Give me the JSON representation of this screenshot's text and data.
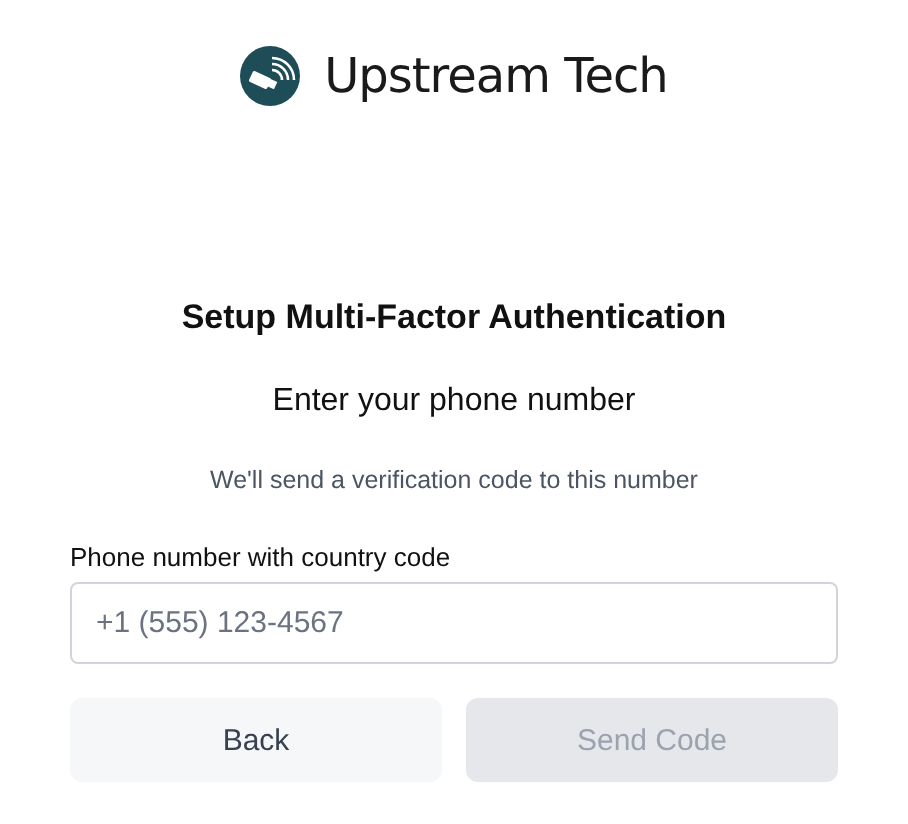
{
  "logo": {
    "name": "Upstream Tech"
  },
  "title": "Setup Multi-Factor Authentication",
  "subtitle": "Enter your phone number",
  "description": "We'll send a verification code to this number",
  "phone_field": {
    "label": "Phone number with country code",
    "placeholder": "+1 (555) 123-4567"
  },
  "buttons": [
    {
      "label": "Back",
      "disabled": false
    },
    {
      "label": "Send Code",
      "disabled": true
    }
  ]
}
